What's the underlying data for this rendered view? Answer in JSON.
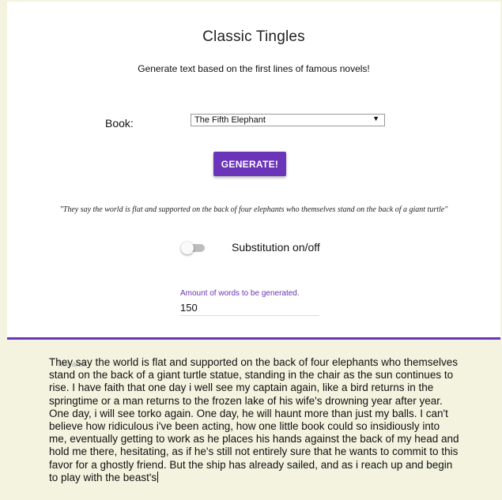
{
  "header": {
    "title": "Classic Tingles",
    "subtitle": "Generate text based on the first lines of famous novels!"
  },
  "form": {
    "book_label": "Book:",
    "book_selected": "The Fifth Elephant",
    "generate_label": "GENERATE!",
    "quote": "\"They say the world is flat and supported on the back of four elephants who themselves stand on the back of a giant turtle\"",
    "substitution_label": "Substitution on/off",
    "substitution_on": false,
    "words_label": "Amount of words to be generated.",
    "words_value": "150"
  },
  "output": {
    "placeholder": "Text area",
    "text": "They say the world is flat and supported on the back of four elephants who themselves stand on the back of a giant turtle statue, standing in the chair as the sun continues to rise. I have faith that one day i well see my captain again, like a bird returns in the springtime or a man returns to the frozen lake of his wife's drowning year after year. One day, i will see torko again. One day, he will haunt more than just my balls. I can't believe how ridiculous i've been acting, how one little book could so insidiously into me, eventually getting to work as he places his hands against the back of my head and hold me there, hesitating, as if he's still not entirely sure that he wants to commit to this favor for a ghostly friend. But the ship has already sailed, and as i reach up and begin to play with the beast's"
  },
  "colors": {
    "accent": "#6a35b8",
    "background": "#f3f3df",
    "card": "#ffffff"
  }
}
